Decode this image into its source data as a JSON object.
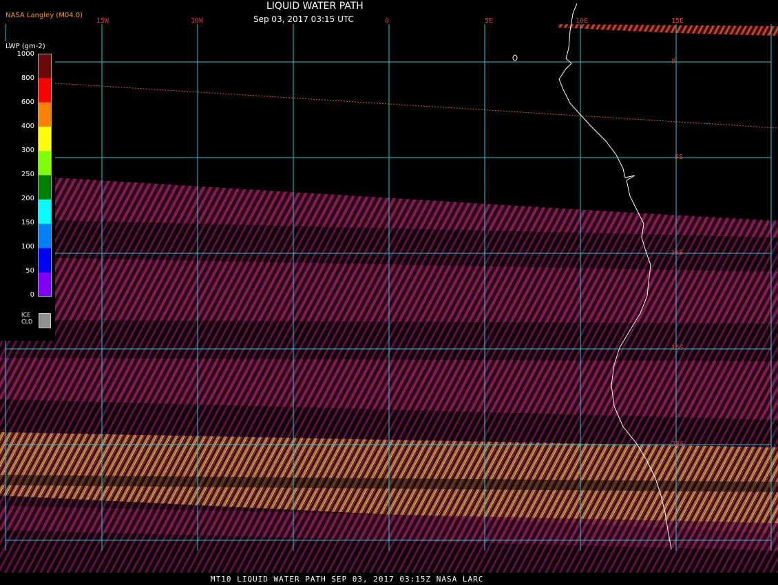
{
  "header": {
    "title": "LIQUID WATER PATH",
    "timestamp": "Sep 03, 2017 03:15 UTC",
    "credit": "NASA Langley (M04.0)"
  },
  "map": {
    "longitude_labels": [
      "15W",
      "10W",
      "0",
      "5E",
      "10E",
      "15E"
    ],
    "latitude_labels": [
      "0",
      "5S",
      "10S",
      "15S",
      "20S"
    ],
    "grid_color": "#28c8d2",
    "label_color": "#d23a3a",
    "coastline_color": "#ffffff"
  },
  "legend": {
    "title": "LWP (gm-2)",
    "ticks": [
      "1000",
      "800",
      "600",
      "400",
      "300",
      "250",
      "200",
      "150",
      "100",
      "50",
      "0"
    ],
    "colors": [
      "#6b0a0a",
      "#ff0000",
      "#ff8000",
      "#ffff00",
      "#80ff00",
      "#008000",
      "#00ffff",
      "#0080ff",
      "#0000ff",
      "#8000ff"
    ],
    "ice_label_1": "ICE",
    "ice_label_2": "CLD",
    "ice_color": "#909090"
  },
  "footer": {
    "text": "MT10  LIQUID WATER PATH   SEP 03, 2017 03:15Z   NASA LARC"
  }
}
